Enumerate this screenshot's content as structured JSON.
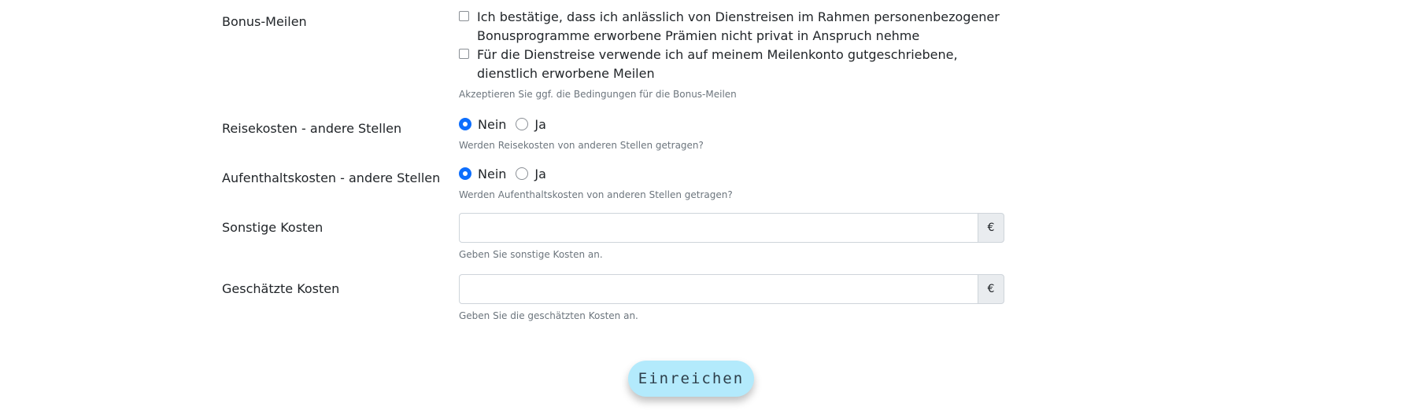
{
  "bonus": {
    "label": "Bonus-Meilen",
    "options": [
      "Ich bestätige, dass ich anlässlich von Dienstreisen im Rahmen personenbezogener Bonusprogramme erworbene Prämien nicht privat in Anspruch nehme",
      "Für die Dienstreise verwende ich auf meinem Meilenkonto gutgeschriebene, dienstlich erworbene Meilen"
    ],
    "help": "Akzeptieren Sie ggf. die Bedingungen für die Bonus-Meilen"
  },
  "reisekosten": {
    "label": "Reisekosten - andere Stellen",
    "option_nein": "Nein",
    "option_ja": "Ja",
    "selected": "Nein",
    "help": "Werden Reisekosten von anderen Stellen getragen?"
  },
  "aufenthaltskosten": {
    "label": "Aufenthaltskosten - andere Stellen",
    "option_nein": "Nein",
    "option_ja": "Ja",
    "selected": "Nein",
    "help": "Werden Aufenthaltskosten von anderen Stellen getragen?"
  },
  "sonstige": {
    "label": "Sonstige Kosten",
    "value": "",
    "currency": "€",
    "help": "Geben Sie sonstige Kosten an."
  },
  "geschaetzte": {
    "label": "Geschätzte Kosten",
    "value": "",
    "currency": "€",
    "help": "Geben Sie die geschätzten Kosten an."
  },
  "submit_label": "Einreichen",
  "colors": {
    "primary": "#0d6efd",
    "submit_bg": "#b3eafc",
    "help_text": "#6c757d"
  }
}
